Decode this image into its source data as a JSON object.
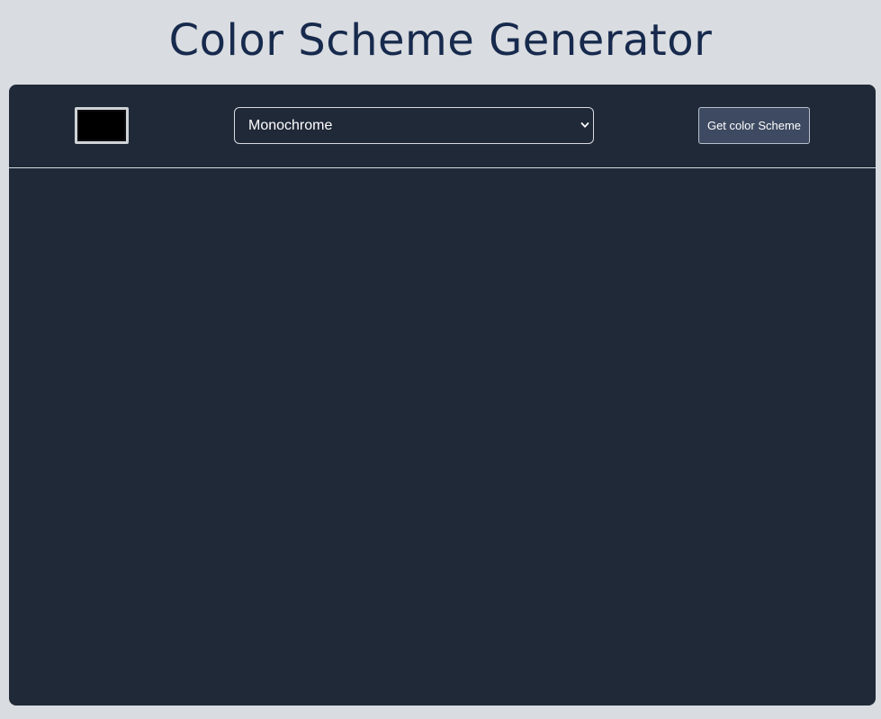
{
  "page": {
    "title": "Color Scheme Generator"
  },
  "controls": {
    "color_picker": {
      "value": "#000000"
    },
    "mode_select": {
      "selected": "Monochrome"
    },
    "submit_button": {
      "label": "Get color Scheme"
    }
  },
  "colors": {
    "page_background": "#d9dce0",
    "title_text": "#172a4d",
    "panel_background": "#202938",
    "button_background": "#3d4a61"
  },
  "icons": {
    "select_arrow": "chevron-down-icon"
  }
}
